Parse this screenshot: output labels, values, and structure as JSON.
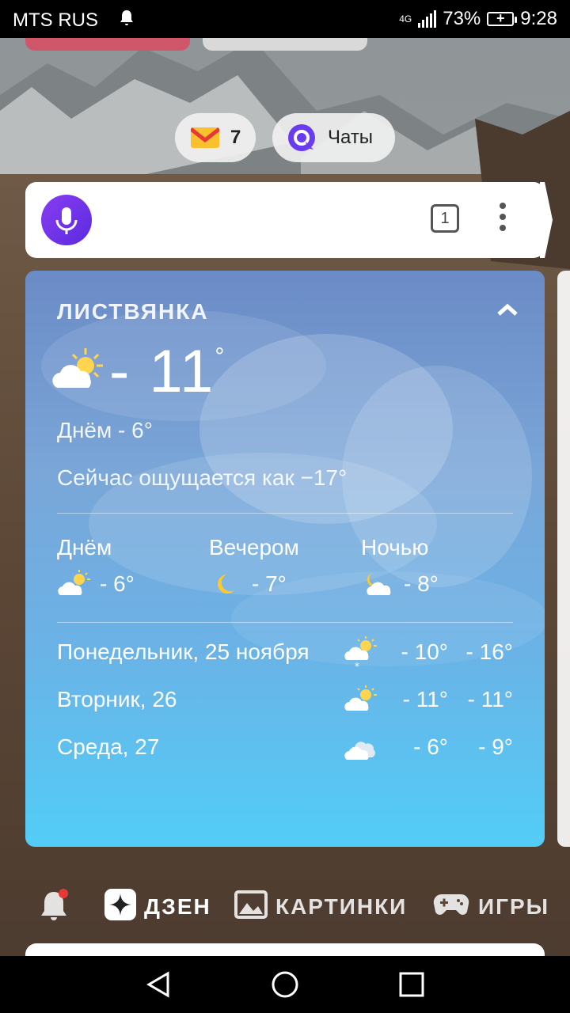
{
  "status_bar": {
    "carrier": "MTS RUS",
    "network": "4G",
    "battery": "73%",
    "time": "9:28",
    "icons": [
      "notification-bell-icon",
      "signal-icon",
      "battery-charging-icon"
    ]
  },
  "chips": {
    "mail": {
      "icon": "mail-icon",
      "count": "7"
    },
    "chats": {
      "icon": "chat-icon",
      "label": "Чаты"
    }
  },
  "search_bar": {
    "mic_icon": "microphone-icon",
    "tab_count": "1",
    "menu_icon": "more-vertical-icon"
  },
  "weather": {
    "city": "ЛИСТВЯНКА",
    "collapse_icon": "chevron-up-icon",
    "current_icon": "partly-cloudy-icon",
    "current_temp": "- 11",
    "degree": "°",
    "day_temp": "Днём - 6°",
    "feels_like": "Сейчас ощущается как −17°",
    "periods": [
      {
        "name": "Днём",
        "icon": "partly-cloudy-icon",
        "temp": "- 6°"
      },
      {
        "name": "Вечером",
        "icon": "moon-icon",
        "temp": "- 7°"
      },
      {
        "name": "Ночью",
        "icon": "partly-cloudy-night-icon",
        "temp": "- 8°"
      }
    ],
    "forecast": [
      {
        "day": "Понедельник, 25 ноября",
        "icon": "partly-cloudy-snow-icon",
        "high": "- 10°",
        "low": "- 16°"
      },
      {
        "day": "Вторник, 26",
        "icon": "partly-cloudy-icon",
        "high": "- 11°",
        "low": "- 11°"
      },
      {
        "day": "Среда, 27",
        "icon": "cloudy-icon",
        "high": "- 6°",
        "low": "- 9°"
      }
    ]
  },
  "services": [
    {
      "icon": "notification-bell-icon",
      "label": ""
    },
    {
      "icon": "zen-icon",
      "label": "ДЗЕН"
    },
    {
      "icon": "image-icon",
      "label": "КАРТИНКИ"
    },
    {
      "icon": "gamepad-icon",
      "label": "ИГРЫ"
    }
  ],
  "nav_bar": {
    "back": "back-triangle-icon",
    "home": "home-circle-icon",
    "recent": "recent-square-icon"
  },
  "colors": {
    "accent_mail_red": "#e53935",
    "accent_mail_yellow": "#fbc02d",
    "accent_alice": "#6a3cf0",
    "weather_top": "#6b8bc6",
    "weather_bottom": "#52cdf7"
  }
}
